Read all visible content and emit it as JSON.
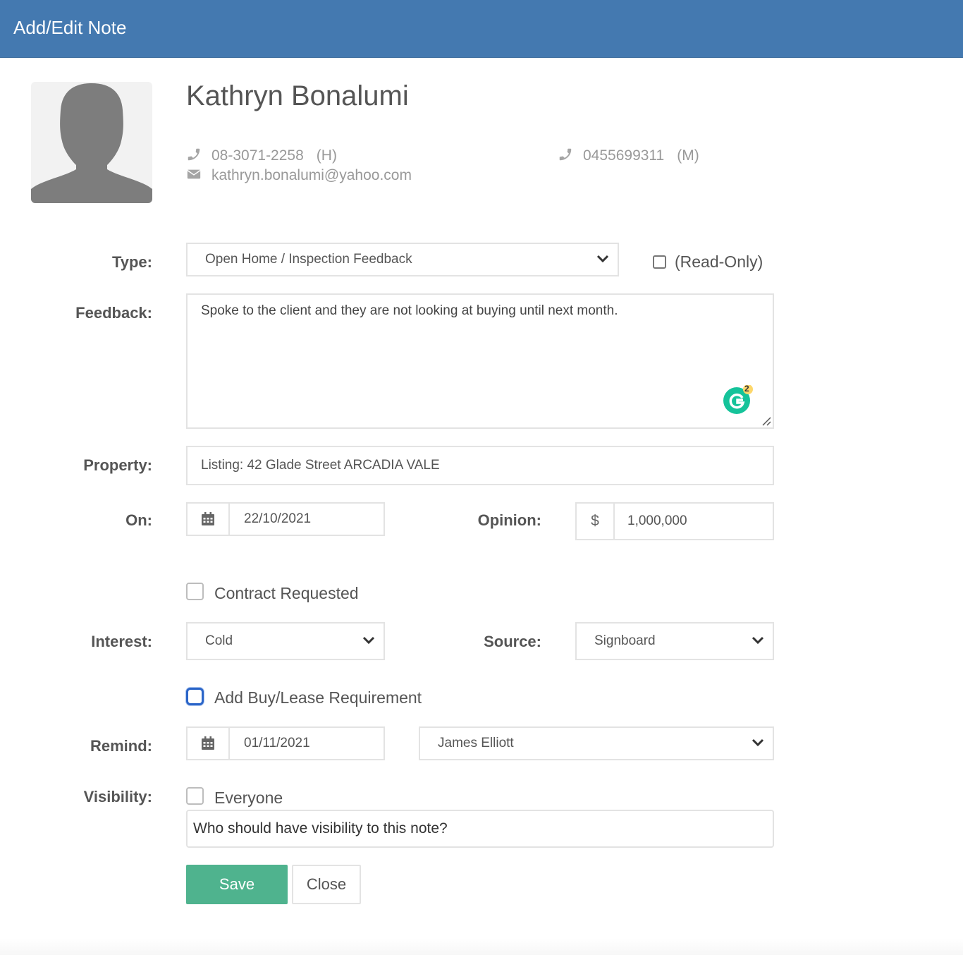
{
  "header": {
    "title": "Add/Edit Note"
  },
  "contact": {
    "name": "Kathryn Bonalumi",
    "home_phone": "08-3071-2258",
    "home_tag": "(H)",
    "mobile_phone": "0455699311",
    "mobile_tag": "(M)",
    "email": "kathryn.bonalumi@yahoo.com",
    "avatar_icon": "person-silhouette-icon"
  },
  "form": {
    "type": {
      "label": "Type:",
      "value": "Open Home / Inspection Feedback"
    },
    "read_only": {
      "label": "(Read-Only)",
      "checked": false
    },
    "feedback": {
      "label": "Feedback:",
      "value": "Spoke to the client and they are not looking at buying until next month.",
      "grammarly_count": "2"
    },
    "property": {
      "label": "Property:",
      "value": "Listing: 42 Glade Street ARCADIA VALE"
    },
    "on": {
      "label": "On:",
      "value": "22/10/2021"
    },
    "opinion": {
      "label": "Opinion:",
      "currency": "$",
      "value": "1,000,000"
    },
    "contract_requested": {
      "label": "Contract Requested",
      "checked": false
    },
    "interest": {
      "label": "Interest:",
      "value": "Cold"
    },
    "source": {
      "label": "Source:",
      "value": "Signboard"
    },
    "buy_lease": {
      "label": "Add Buy/Lease Requirement",
      "checked": false
    },
    "remind": {
      "label": "Remind:",
      "date": "01/11/2021",
      "assignee": "James Elliott"
    },
    "visibility": {
      "label": "Visibility:",
      "everyone_label": "Everyone",
      "everyone_checked": false,
      "placeholder": "Who should have visibility to this note?"
    }
  },
  "buttons": {
    "save": "Save",
    "close": "Close"
  },
  "colors": {
    "header": "#4479b0",
    "save": "#4fb38e",
    "grammarly": "#15c39a",
    "focus": "#2b65c8"
  }
}
